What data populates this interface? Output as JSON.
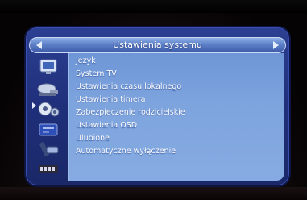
{
  "window": {
    "title": "Ustawienia systemu"
  },
  "icons": [
    {
      "name": "tv-screen-icon"
    },
    {
      "name": "satellite-dish-icon"
    },
    {
      "name": "gears-icon"
    },
    {
      "name": "media-card-icon"
    },
    {
      "name": "remote-control-icon"
    },
    {
      "name": "film-strip-icon"
    }
  ],
  "menu": {
    "selected_icon_index": 2,
    "items": [
      {
        "label": "Jezyk"
      },
      {
        "label": "System TV"
      },
      {
        "label": "Ustawienia czasu lokalnego"
      },
      {
        "label": "Ustawienia timera"
      },
      {
        "label": "Zabezpieczenie rodzicielskie"
      },
      {
        "label": "Ustawienia OSD"
      },
      {
        "label": "Ulubione"
      },
      {
        "label": "Automatyczne wyłączenie"
      }
    ]
  },
  "colors": {
    "panel": "#1f2f7a",
    "list_background": "#7ea4de",
    "text": "#ffffff"
  }
}
